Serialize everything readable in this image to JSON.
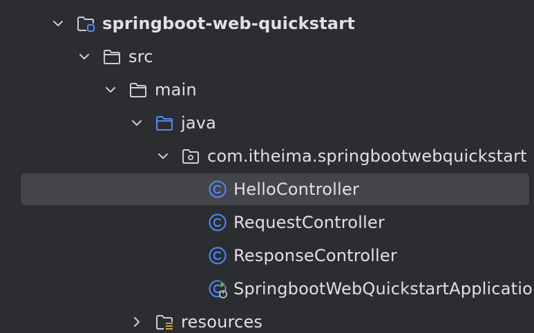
{
  "colors": {
    "background": "#2b2d30",
    "selection": "#43454a",
    "text": "#dfe1e5",
    "folder_icon": "#ced0d6",
    "source_folder_icon": "#548af7",
    "class_icon": "#548af7",
    "run_icon": "#5fb865"
  },
  "tree": {
    "items": [
      {
        "label": "springboot-web-quickstart",
        "icon": "module-folder-icon",
        "expanded": true
      },
      {
        "label": "src",
        "icon": "folder-icon",
        "expanded": true
      },
      {
        "label": "main",
        "icon": "folder-icon",
        "expanded": true
      },
      {
        "label": "java",
        "icon": "source-folder-icon",
        "expanded": true
      },
      {
        "label": "com.itheima.springbootwebquickstart",
        "icon": "package-icon",
        "expanded": true
      },
      {
        "label": "HelloController",
        "icon": "class-icon",
        "selected": true
      },
      {
        "label": "RequestController",
        "icon": "class-icon"
      },
      {
        "label": "ResponseController",
        "icon": "class-icon"
      },
      {
        "label": "SpringbootWebQuickstartApplication",
        "icon": "spring-boot-application-class-icon"
      },
      {
        "label": "resources",
        "icon": "resources-folder-icon",
        "expanded": false
      }
    ]
  }
}
